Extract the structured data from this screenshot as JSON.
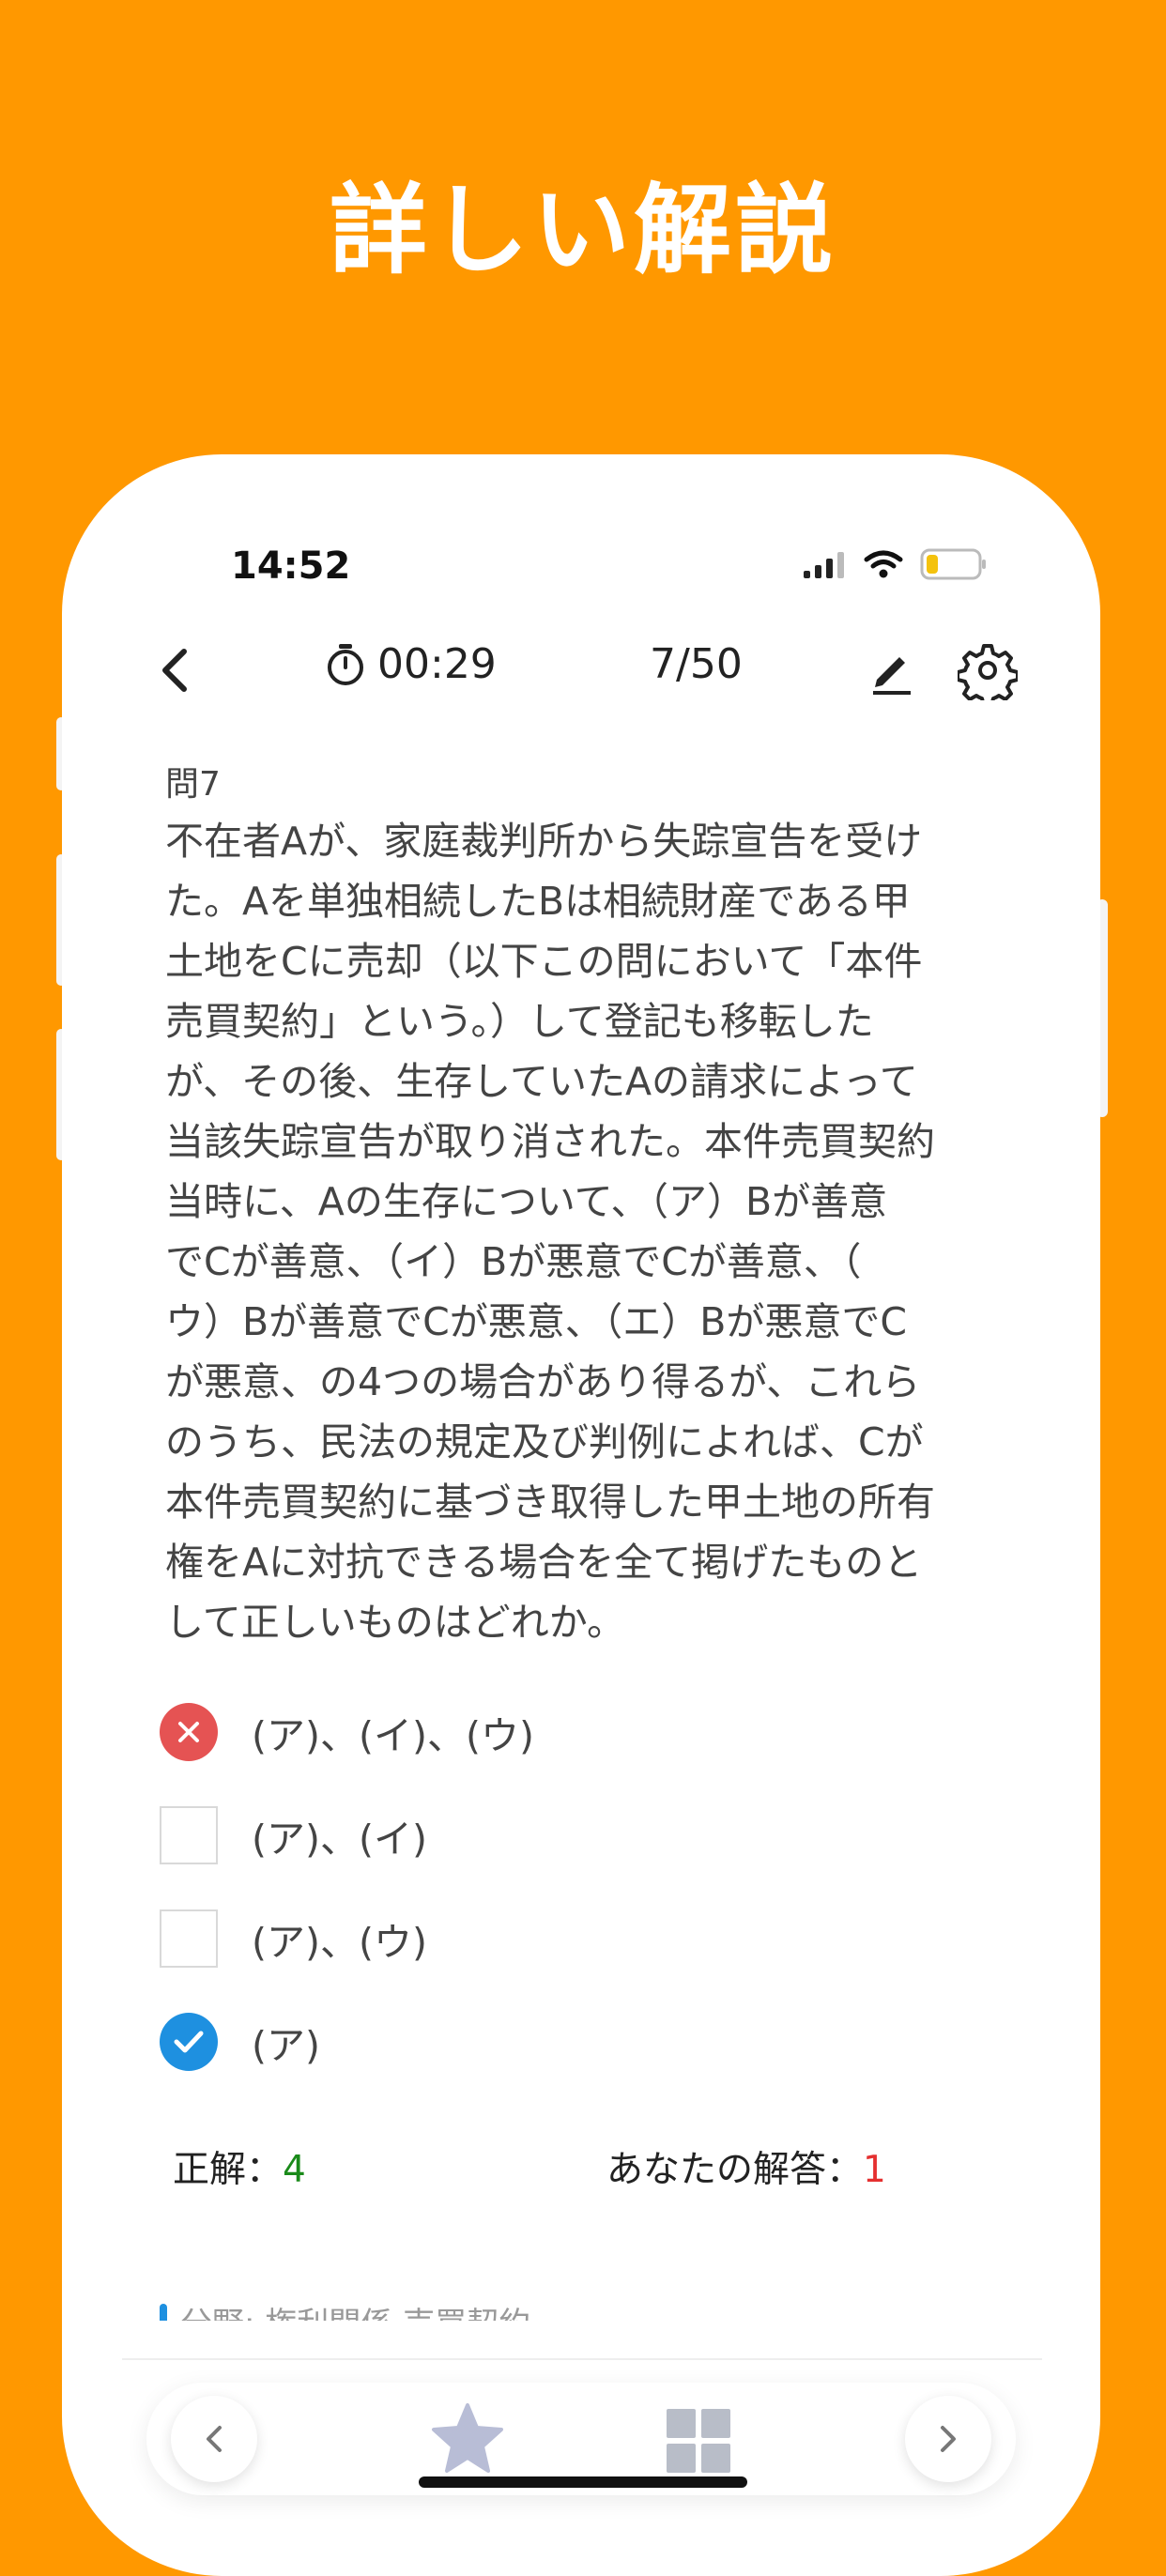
{
  "promo": {
    "title": "詳しい解説"
  },
  "status_bar": {
    "time": "14:52"
  },
  "nav": {
    "timer": "00:29",
    "progress": "7/50"
  },
  "question": {
    "number": "問7",
    "lines": [
      "不在者Aが、家庭裁判所から失踪宣告を受け",
      "た。Aを単独相続したBは相続財産である甲",
      "土地をCに売却（以下この問において「本件",
      "売買契約」という。）して登記も移転した",
      "が、その後、生存していたAの請求によって",
      "当該失踪宣告が取り消された。本件売買契約",
      "当時に、Aの生存について、（ア）Bが善意",
      "でCが善意、（イ）Bが悪意でCが善意、（",
      "ウ）Bが善意でCが悪意、（エ）Bが悪意でC",
      "が悪意、の4つの場合があり得るが、これら",
      "のうち、民法の規定及び判例によれば、Cが",
      "本件売買契約に基づき取得した甲土地の所有",
      "権をAに対抗できる場合を全て掲げたものと",
      "して正しいものはどれか。"
    ]
  },
  "options": [
    {
      "label": "(ア)、(イ)、(ウ)",
      "state": "wrong"
    },
    {
      "label": "(ア)、(イ)",
      "state": "empty"
    },
    {
      "label": "(ア)、(ウ)",
      "state": "empty"
    },
    {
      "label": "(ア)",
      "state": "correct"
    }
  ],
  "result": {
    "correct_label": "正解：",
    "correct_value": "4",
    "your_label": "あなたの解答：",
    "your_value": "1"
  },
  "category": {
    "text": "分野: 権利関係  売買契約"
  },
  "colors": {
    "background": "#FF9800",
    "wrong": "#E55353",
    "correct": "#1E90E0",
    "correct_text": "#1a8a1a",
    "your_text": "#E53030"
  },
  "icons": {
    "nav": [
      "chevron-left-icon",
      "stopwatch-icon",
      "pencil-icon",
      "gear-icon"
    ],
    "toolbar": [
      "chevron-left-icon",
      "star-icon",
      "grid-icon",
      "chevron-right-icon"
    ]
  }
}
